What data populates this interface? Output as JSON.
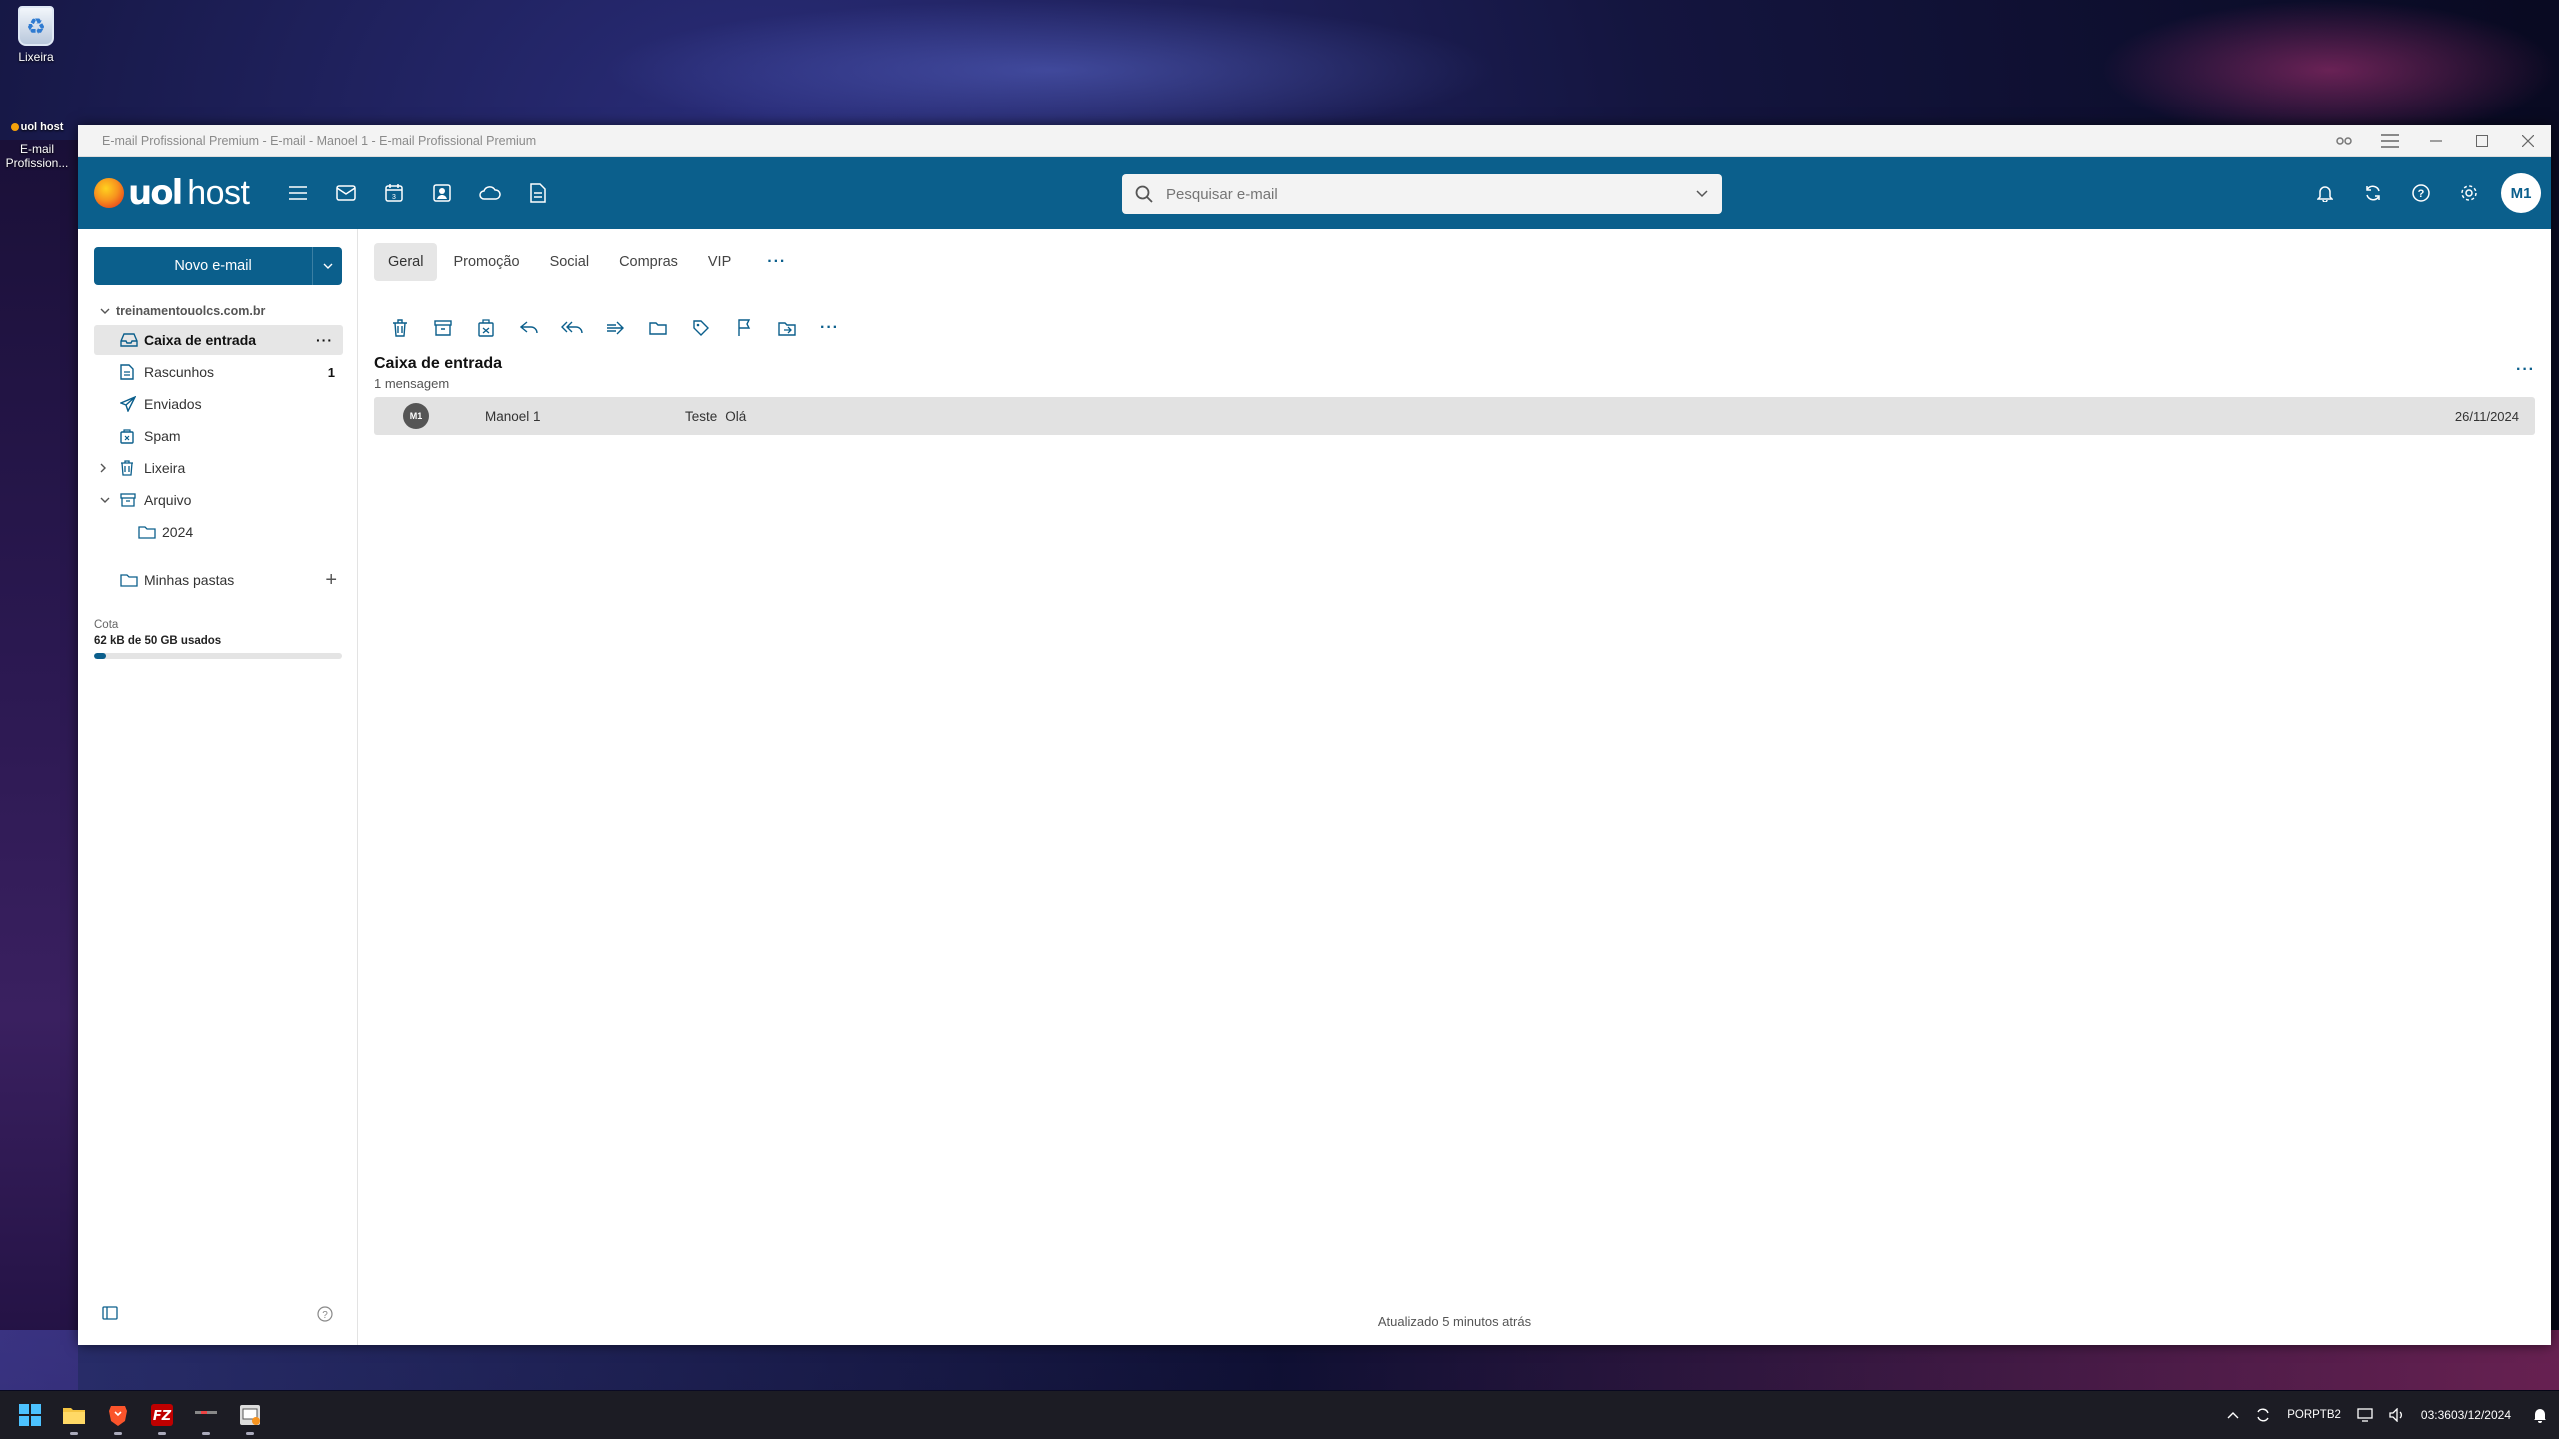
{
  "desktop": {
    "recycle_label": "Lixeira",
    "shortcut_brand": "uol host",
    "shortcut_label_1": "E-mail",
    "shortcut_label_2": "Profission..."
  },
  "window": {
    "title": "E-mail Profissional Premium - E-mail - Manoel 1 - E-mail Profissional Premium"
  },
  "header": {
    "logo_uol": "uol",
    "logo_host": "host",
    "search_placeholder": "Pesquisar e-mail",
    "avatar_initials": "M1",
    "accent": "#0b5f8c"
  },
  "sidebar": {
    "new_email_label": "Novo e-mail",
    "account": "treinamentouolcs.com.br",
    "folders": [
      {
        "label": "Caixa de entrada",
        "icon": "inbox-icon",
        "active": true
      },
      {
        "label": "Rascunhos",
        "icon": "draft-icon",
        "count": "1"
      },
      {
        "label": "Enviados",
        "icon": "send-icon"
      },
      {
        "label": "Spam",
        "icon": "spam-icon"
      },
      {
        "label": "Lixeira",
        "icon": "trash-icon"
      },
      {
        "label": "Arquivo",
        "icon": "archive-icon"
      },
      {
        "label": "2024",
        "icon": "folder-icon"
      }
    ],
    "my_folders": "Minhas pastas",
    "quota_label": "Cota",
    "quota_used": "62 kB de 50 GB usados",
    "quota_fraction": 0.05
  },
  "tabs": [
    "Geral",
    "Promoção",
    "Social",
    "Compras",
    "VIP"
  ],
  "list": {
    "title": "Caixa de entrada",
    "count": "1 mensagem",
    "messages": [
      {
        "avatar": "M1",
        "from": "Manoel 1",
        "subject": "Teste",
        "preview": "Olá",
        "date": "26/11/2024"
      }
    ]
  },
  "status": "Atualizado 5 minutos atrás",
  "taskbar": {
    "lang_1": "POR",
    "lang_2": "PTB2",
    "time": "03:36",
    "date": "03/12/2024"
  }
}
